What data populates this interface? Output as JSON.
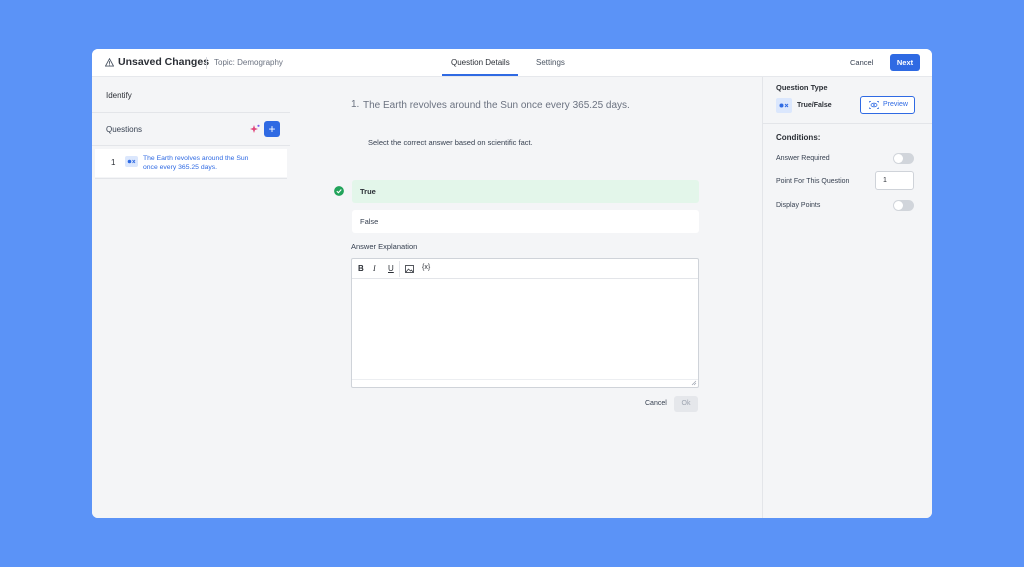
{
  "header": {
    "title": "Unsaved Changes",
    "topic": "Topic: Demography",
    "tabs": [
      "Question Details",
      "Settings"
    ],
    "cancel_label": "Cancel",
    "next_label": "Next"
  },
  "sidebar": {
    "section_label": "Identify",
    "questions_label": "Questions",
    "add_label": "+",
    "items": [
      {
        "number": "1",
        "text": "The Earth revolves around the Sun once every 365.25 days."
      }
    ]
  },
  "question": {
    "number": "1.",
    "title": "The Earth revolves around the Sun once every 365.25 days.",
    "instruction": "Select the correct answer based on scientific fact.",
    "options": [
      {
        "label": "True",
        "correct": true
      },
      {
        "label": "False",
        "correct": false
      }
    ],
    "explanation_label": "Answer Explanation",
    "editor_tools": [
      "B",
      "I",
      "U",
      "image-icon",
      "variable-icon"
    ],
    "variable_label": "{x}",
    "cancel_label": "Cancel",
    "ok_label": "Ok"
  },
  "settings_panel": {
    "question_type_label": "Question Type",
    "question_type_value": "True/False",
    "preview_label": "Preview",
    "conditions_label": "Conditions:",
    "answer_required_label": "Answer Required",
    "answer_required": false,
    "points_label": "Point For This Question",
    "points_value": "1",
    "display_points_label": "Display Points",
    "display_points": false
  },
  "colors": {
    "background": "#5b93f7",
    "accent": "#2f6ae3",
    "correct_fill": "#e3f6ea",
    "correct_check": "#22a35b"
  }
}
